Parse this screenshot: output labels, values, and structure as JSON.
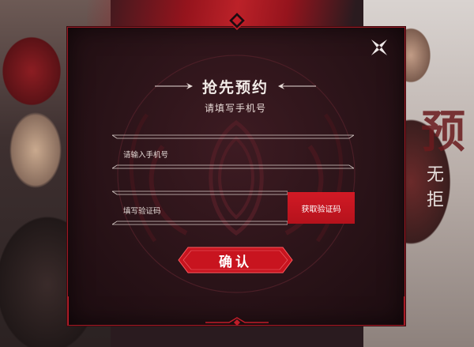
{
  "background": {
    "left_glyph_large": "预",
    "right_glyph_small": "无 拒"
  },
  "dialog": {
    "title": "抢先预约",
    "subtitle": "请填写手机号",
    "phone_field": {
      "placeholder": "请输入手机号"
    },
    "code_field": {
      "placeholder": "填写验证码"
    },
    "get_code_button": "获取验证码",
    "confirm_button": "确认",
    "close_icon": "close-x-icon"
  },
  "colors": {
    "accent_red": "#d21a25",
    "panel_bg": "#2a1318",
    "border": "#9b1a24"
  }
}
